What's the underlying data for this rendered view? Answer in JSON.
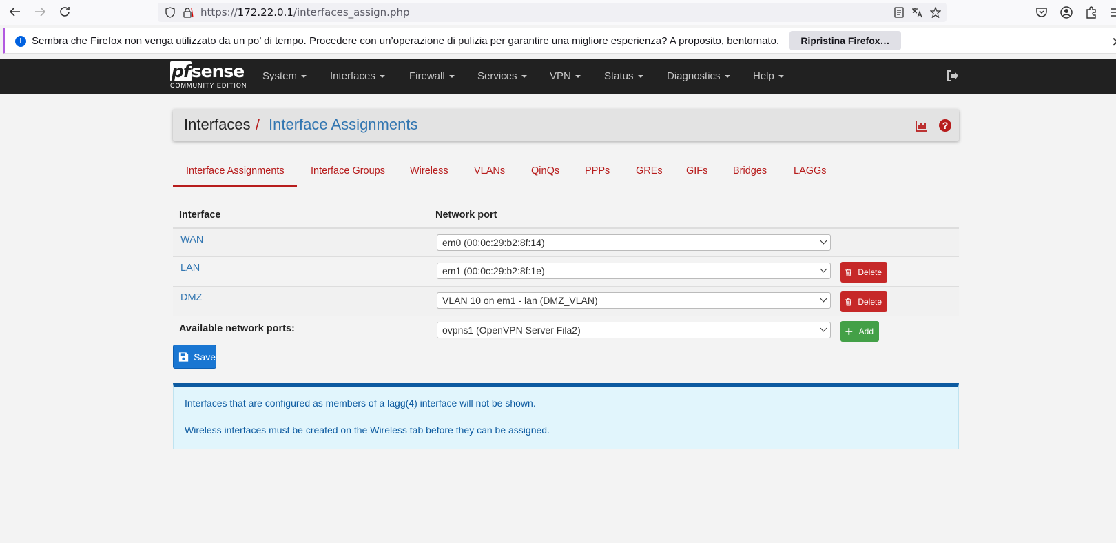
{
  "browser": {
    "url_scheme": "https://",
    "url_host": "172.22.0.1",
    "url_path": "/interfaces_assign.php"
  },
  "notification": {
    "text": "Sembra che Firefox non venga utilizzato da un po’ di tempo. Procedere con un’operazione di pulizia per garantire una migliore esperienza? A proposito, bentornato.",
    "button_label": "Ripristina Firefox…"
  },
  "navbar": {
    "logo_text": "sense",
    "logo_prefix": "pf",
    "logo_subtitle": "COMMUNITY EDITION",
    "items": [
      "System",
      "Interfaces",
      "Firewall",
      "Services",
      "VPN",
      "Status",
      "Diagnostics",
      "Help"
    ]
  },
  "header": {
    "crumb": "Interfaces",
    "separator": "/",
    "title": "Interface Assignments"
  },
  "tabs": [
    "Interface Assignments",
    "Interface Groups",
    "Wireless",
    "VLANs",
    "QinQs",
    "PPPs",
    "GREs",
    "GIFs",
    "Bridges",
    "LAGGs"
  ],
  "table": {
    "headers": {
      "interface": "Interface",
      "port": "Network port"
    },
    "rows": [
      {
        "interface": "WAN",
        "port": "em0 (00:0c:29:b2:8f:14)",
        "action": ""
      },
      {
        "interface": "LAN",
        "port": "em1 (00:0c:29:b2:8f:1e)",
        "action": "Delete"
      },
      {
        "interface": "DMZ",
        "port": "VLAN 10 on em1 - lan (DMZ_VLAN)",
        "action": "Delete"
      }
    ],
    "available": {
      "label": "Available network ports:",
      "port": "ovpns1 (OpenVPN Server Fila2)",
      "action": "Add"
    }
  },
  "save_label": "Save",
  "info": [
    "Interfaces that are configured as members of a lagg(4) interface will not be shown.",
    "Wireless interfaces must be created on the Wireless tab before they can be assigned."
  ],
  "colors": {
    "danger": "#c62828",
    "success": "#43a047",
    "primary": "#1976d2",
    "link": "#3276b1",
    "navbar": "#212121"
  }
}
